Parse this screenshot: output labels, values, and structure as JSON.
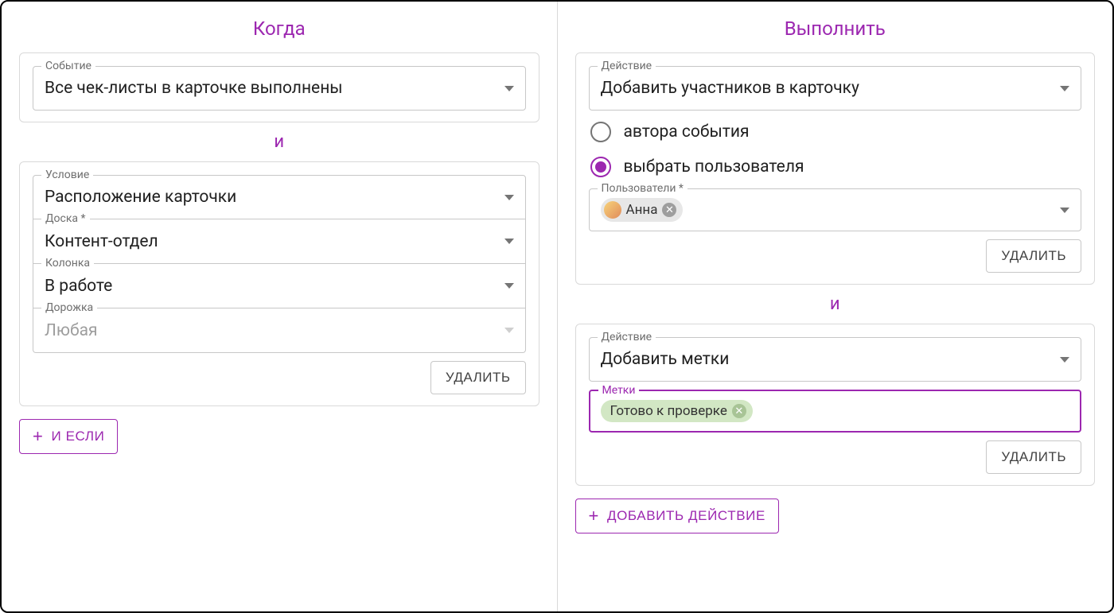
{
  "colors": {
    "accent": "#9c27b0"
  },
  "labels": {
    "delete": "УДАЛИТЬ",
    "and_if": "И ЕСЛИ",
    "add_action": "ДОБАВИТЬ ДЕЙСТВИЕ",
    "and": "и"
  },
  "left": {
    "title": "Когда",
    "event": {
      "label": "Событие",
      "value": "Все чек-листы в карточке выполнены"
    },
    "condition": {
      "label": "Условие",
      "value": "Расположение карточки",
      "board_label": "Доска *",
      "board_value": "Контент-отдел",
      "column_label": "Колонка",
      "column_value": "В работе",
      "lane_label": "Дорожка",
      "lane_placeholder": "Любая"
    }
  },
  "right": {
    "title": "Выполнить",
    "action1": {
      "label": "Действие",
      "value": "Добавить участников в карточку",
      "opt_author": "автора события",
      "opt_select_user": "выбрать пользователя",
      "users_label": "Пользователи *",
      "user_chip": "Анна"
    },
    "action2": {
      "label": "Действие",
      "value": "Добавить метки",
      "tags_label": "Метки",
      "tag_chip": "Готово к проверке"
    }
  }
}
